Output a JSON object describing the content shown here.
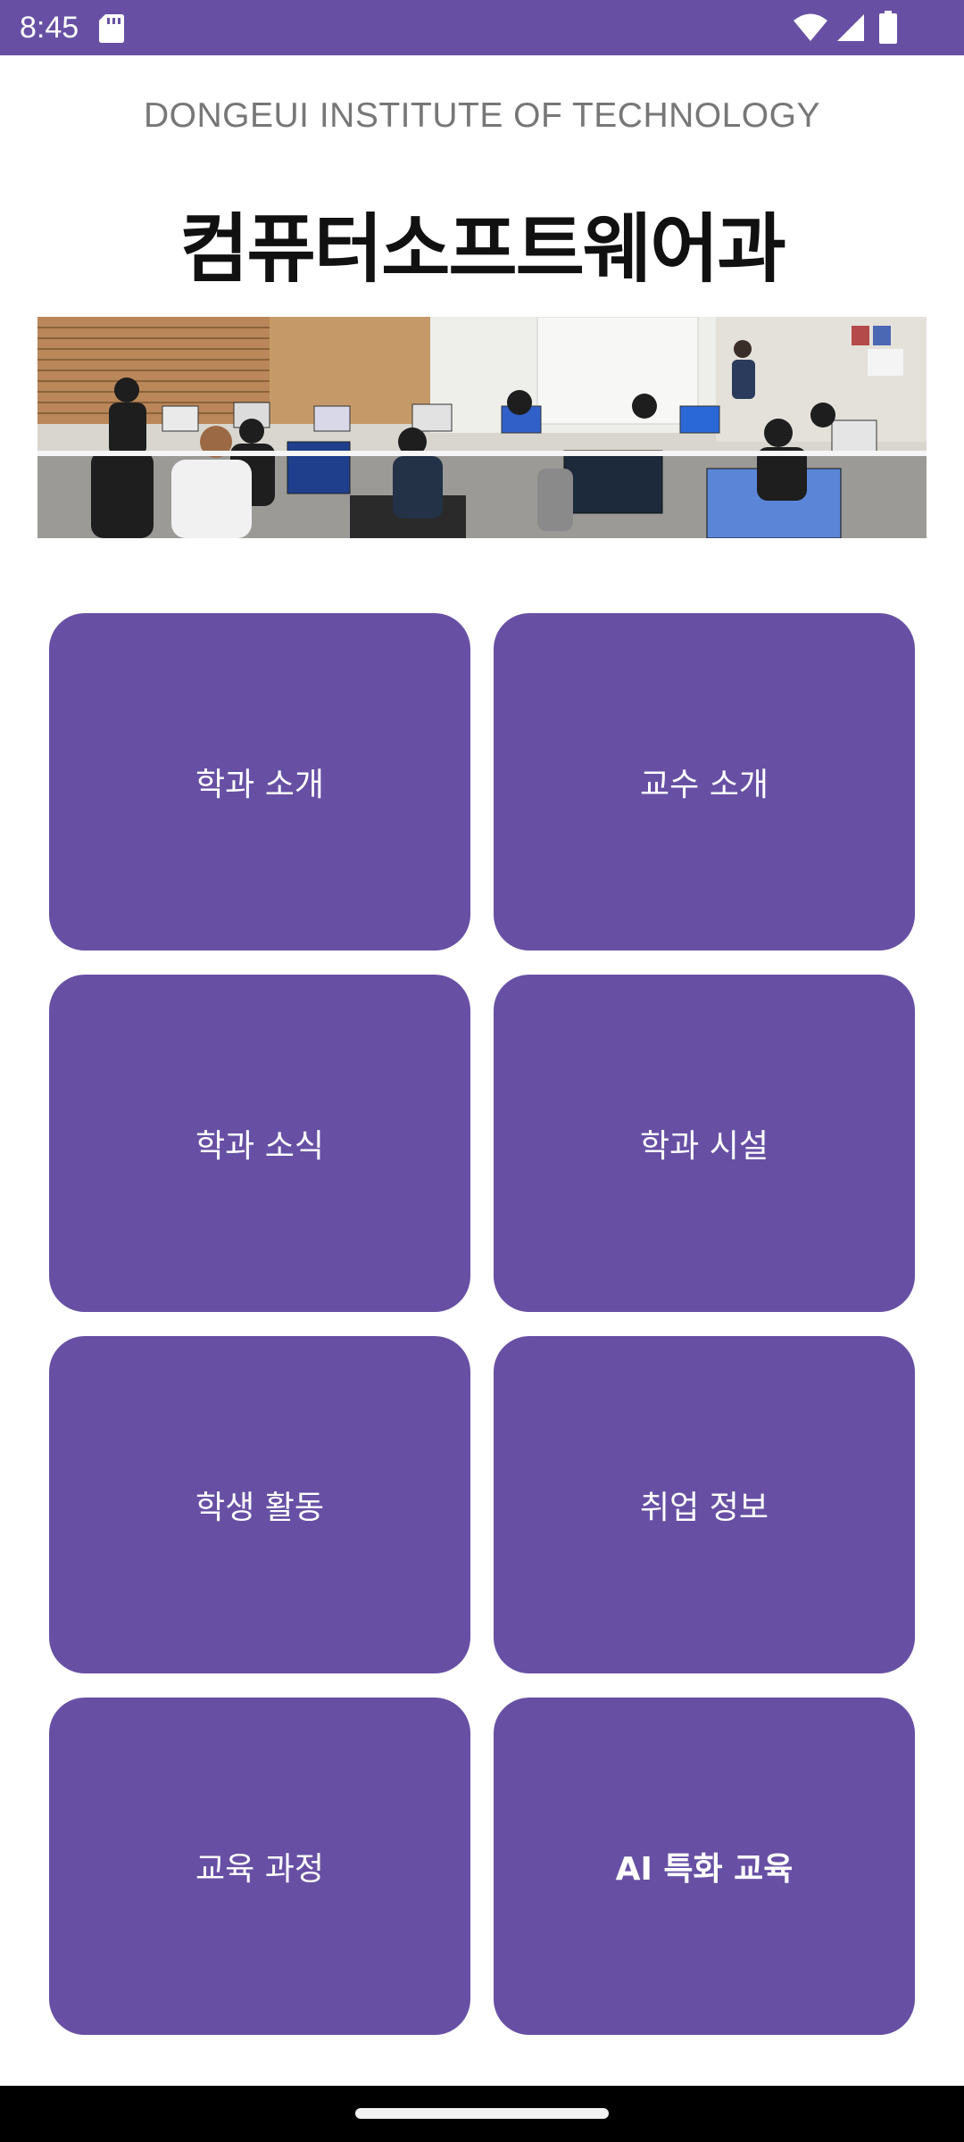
{
  "status_bar": {
    "time": "8:45",
    "icons": [
      "sd-card-icon",
      "wifi-icon",
      "signal-icon",
      "battery-icon"
    ],
    "background_color": "#6750A4"
  },
  "header": {
    "institute": "DONGEUI INSTITUTE OF TECHNOLOGY",
    "department": "컴퓨터소프트웨어과"
  },
  "banner": {
    "description_icon": "classroom-photo"
  },
  "menu": {
    "accent_color": "#6750A4",
    "items": [
      {
        "label": "학과 소개"
      },
      {
        "label": "교수 소개"
      },
      {
        "label": "학과 소식"
      },
      {
        "label": "학과 시설"
      },
      {
        "label": "학생 활동"
      },
      {
        "label": "취업 정보"
      },
      {
        "label": "교육 과정"
      },
      {
        "label": "AI 특화 교육"
      }
    ]
  }
}
